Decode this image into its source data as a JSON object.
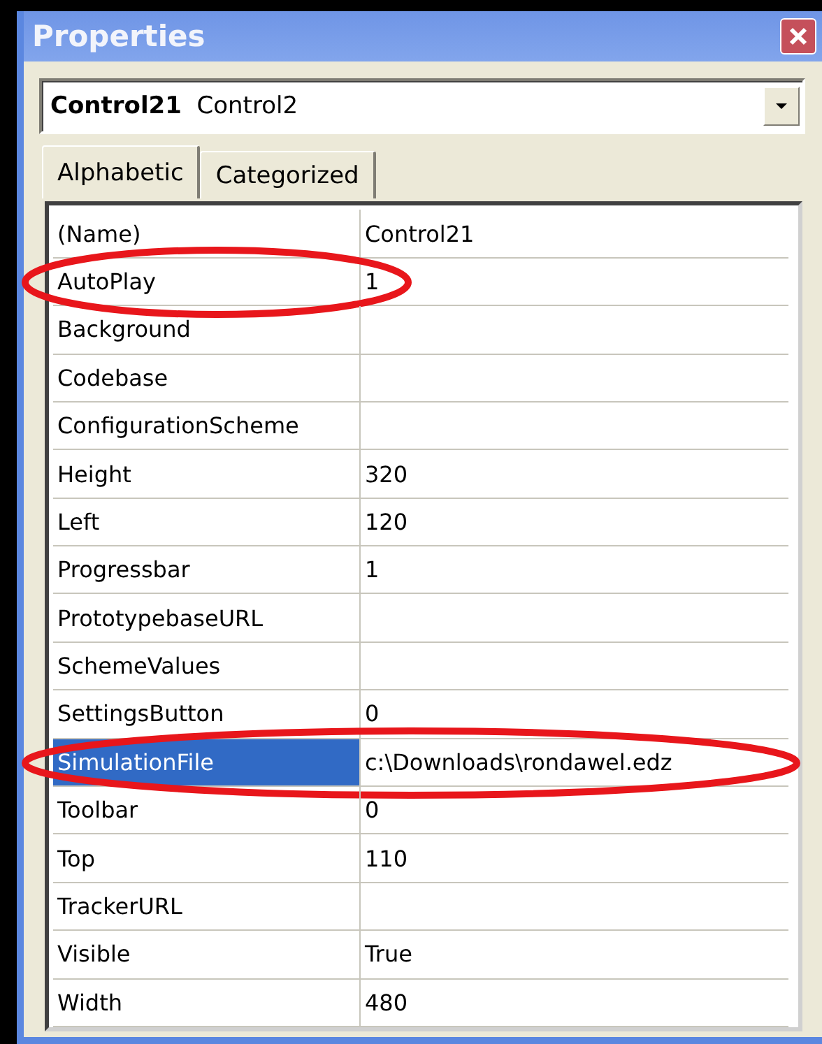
{
  "window": {
    "title": "Properties"
  },
  "object_selector": {
    "name": "Control21",
    "type": "Control2"
  },
  "tabs": [
    {
      "label": "Alphabetic",
      "selected": true
    },
    {
      "label": "Categorized",
      "selected": false
    }
  ],
  "properties": [
    {
      "name": "(Name)",
      "value": "Control21",
      "selected": false,
      "circled": false
    },
    {
      "name": "AutoPlay",
      "value": "1",
      "selected": false,
      "circled": true
    },
    {
      "name": "Background",
      "selected": false,
      "circled": false
    },
    {
      "name": "Codebase",
      "selected": false,
      "circled": false
    },
    {
      "name": "ConfigurationScheme",
      "selected": false,
      "circled": false
    },
    {
      "name": "Height",
      "value": "320",
      "selected": false,
      "circled": false
    },
    {
      "name": "Left",
      "value": "120",
      "selected": false,
      "circled": false
    },
    {
      "name": "Progressbar",
      "value": "1",
      "selected": false,
      "circled": false
    },
    {
      "name": "PrototypebaseURL",
      "selected": false,
      "circled": false
    },
    {
      "name": "SchemeValues",
      "selected": false,
      "circled": false
    },
    {
      "name": "SettingsButton",
      "value": "0",
      "selected": false,
      "circled": false
    },
    {
      "name": "SimulationFile",
      "value": "c:\\Downloads\\rondawel.edz",
      "selected": true,
      "circled": true
    },
    {
      "name": "Toolbar",
      "value": "0",
      "selected": false,
      "circled": false
    },
    {
      "name": "Top",
      "value": "110",
      "selected": false,
      "circled": false
    },
    {
      "name": "TrackerURL",
      "selected": false,
      "circled": false
    },
    {
      "name": "Visible",
      "value": "True",
      "selected": false,
      "circled": false
    },
    {
      "name": "Width",
      "value": "480",
      "selected": false,
      "circled": false
    }
  ]
}
